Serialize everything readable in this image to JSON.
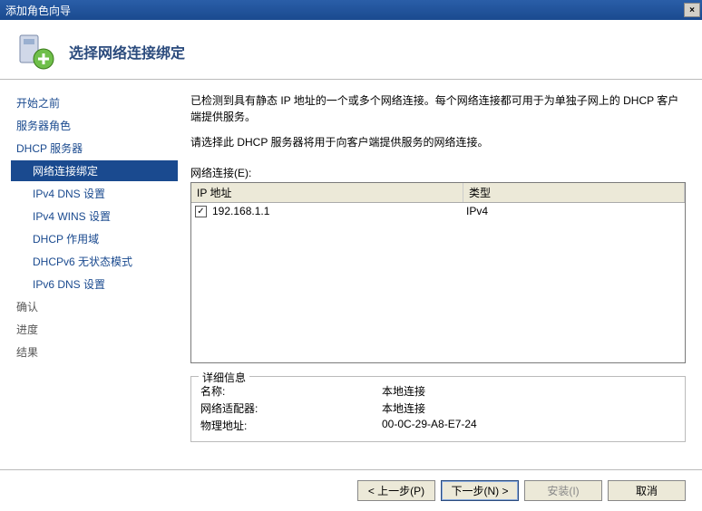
{
  "window": {
    "title": "添加角色向导",
    "close_label": "×"
  },
  "header": {
    "title": "选择网络连接绑定"
  },
  "sidebar": {
    "items": [
      {
        "label": "开始之前",
        "indent": false,
        "selected": false,
        "plain": false
      },
      {
        "label": "服务器角色",
        "indent": false,
        "selected": false,
        "plain": false
      },
      {
        "label": "DHCP 服务器",
        "indent": false,
        "selected": false,
        "plain": false
      },
      {
        "label": "网络连接绑定",
        "indent": true,
        "selected": true,
        "plain": false
      },
      {
        "label": "IPv4 DNS 设置",
        "indent": true,
        "selected": false,
        "plain": false
      },
      {
        "label": "IPv4 WINS 设置",
        "indent": true,
        "selected": false,
        "plain": false
      },
      {
        "label": "DHCP 作用域",
        "indent": true,
        "selected": false,
        "plain": false
      },
      {
        "label": "DHCPv6 无状态模式",
        "indent": true,
        "selected": false,
        "plain": false
      },
      {
        "label": "IPv6 DNS 设置",
        "indent": true,
        "selected": false,
        "plain": false
      },
      {
        "label": "确认",
        "indent": false,
        "selected": false,
        "plain": true
      },
      {
        "label": "进度",
        "indent": false,
        "selected": false,
        "plain": true
      },
      {
        "label": "结果",
        "indent": false,
        "selected": false,
        "plain": true
      }
    ]
  },
  "content": {
    "desc1": "已检测到具有静态 IP 地址的一个或多个网络连接。每个网络连接都可用于为单独子网上的 DHCP 客户端提供服务。",
    "desc2": "请选择此 DHCP 服务器将用于向客户端提供服务的网络连接。",
    "list_label": "网络连接(E):",
    "columns": {
      "ip": "IP 地址",
      "type": "类型"
    },
    "rows": [
      {
        "checked": true,
        "ip": "192.168.1.1",
        "type": "IPv4"
      }
    ],
    "details_title": "详细信息",
    "details": [
      {
        "label": "名称:",
        "value": "本地连接"
      },
      {
        "label": "网络适配器:",
        "value": "本地连接"
      },
      {
        "label": "物理地址:",
        "value": "00-0C-29-A8-E7-24"
      }
    ]
  },
  "footer": {
    "prev": "< 上一步(P)",
    "next": "下一步(N) >",
    "install": "安装(I)",
    "cancel": "取消"
  }
}
